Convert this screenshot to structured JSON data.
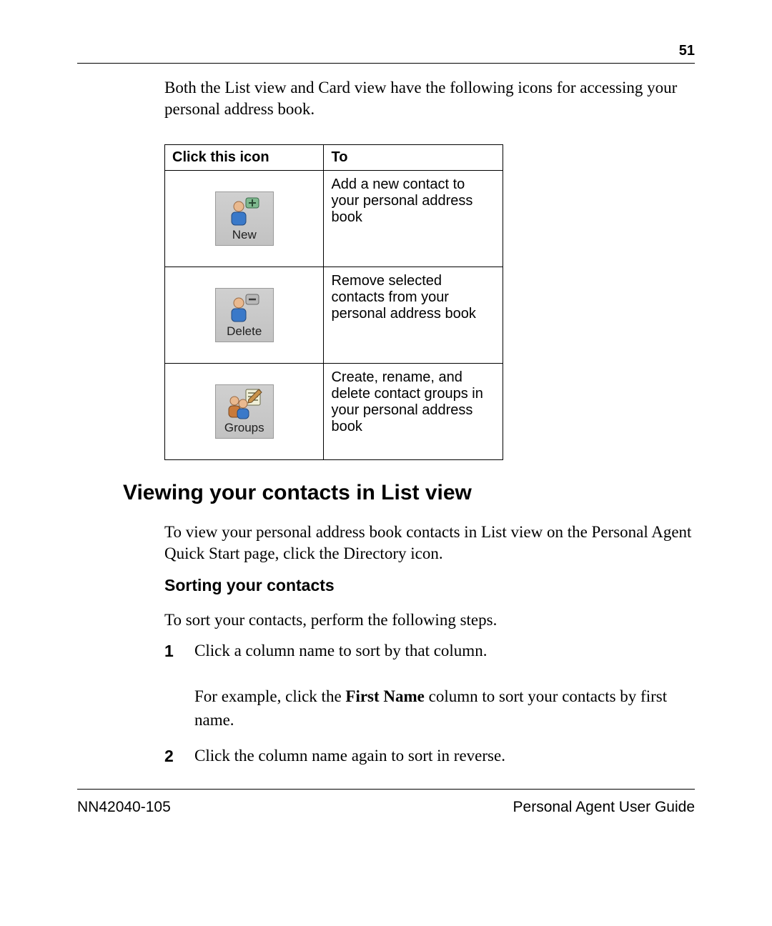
{
  "page_number": "51",
  "intro": "Both the List view and Card view have the following icons for accessing your personal address book.",
  "table": {
    "col1": "Click this icon",
    "col2": "To",
    "rows": [
      {
        "caption": "New",
        "description": "Add a new contact to your personal address book"
      },
      {
        "caption": "Delete",
        "description": "Remove selected contacts from your personal address book"
      },
      {
        "caption": "Groups",
        "description": "Create, rename, and delete contact groups in your personal address book"
      }
    ]
  },
  "h1": "Viewing your contacts in List view",
  "p_after_h1": "To view your personal address book contacts in List view on the Personal Agent Quick Start page, click the Directory icon.",
  "h2": "Sorting your contacts",
  "p_after_h2": "To sort your contacts, perform the following steps.",
  "steps": {
    "s1": {
      "num": "1",
      "line1a": "Click a column name to sort by that column.",
      "line2a": "For example, click the ",
      "line2b": "First Name",
      "line2c": " column to sort your contacts by first name."
    },
    "s2": {
      "num": "2",
      "line1a": "Click the column name again to sort in reverse."
    }
  },
  "footer": {
    "left": "NN42040-105",
    "right": "Personal Agent User Guide"
  }
}
